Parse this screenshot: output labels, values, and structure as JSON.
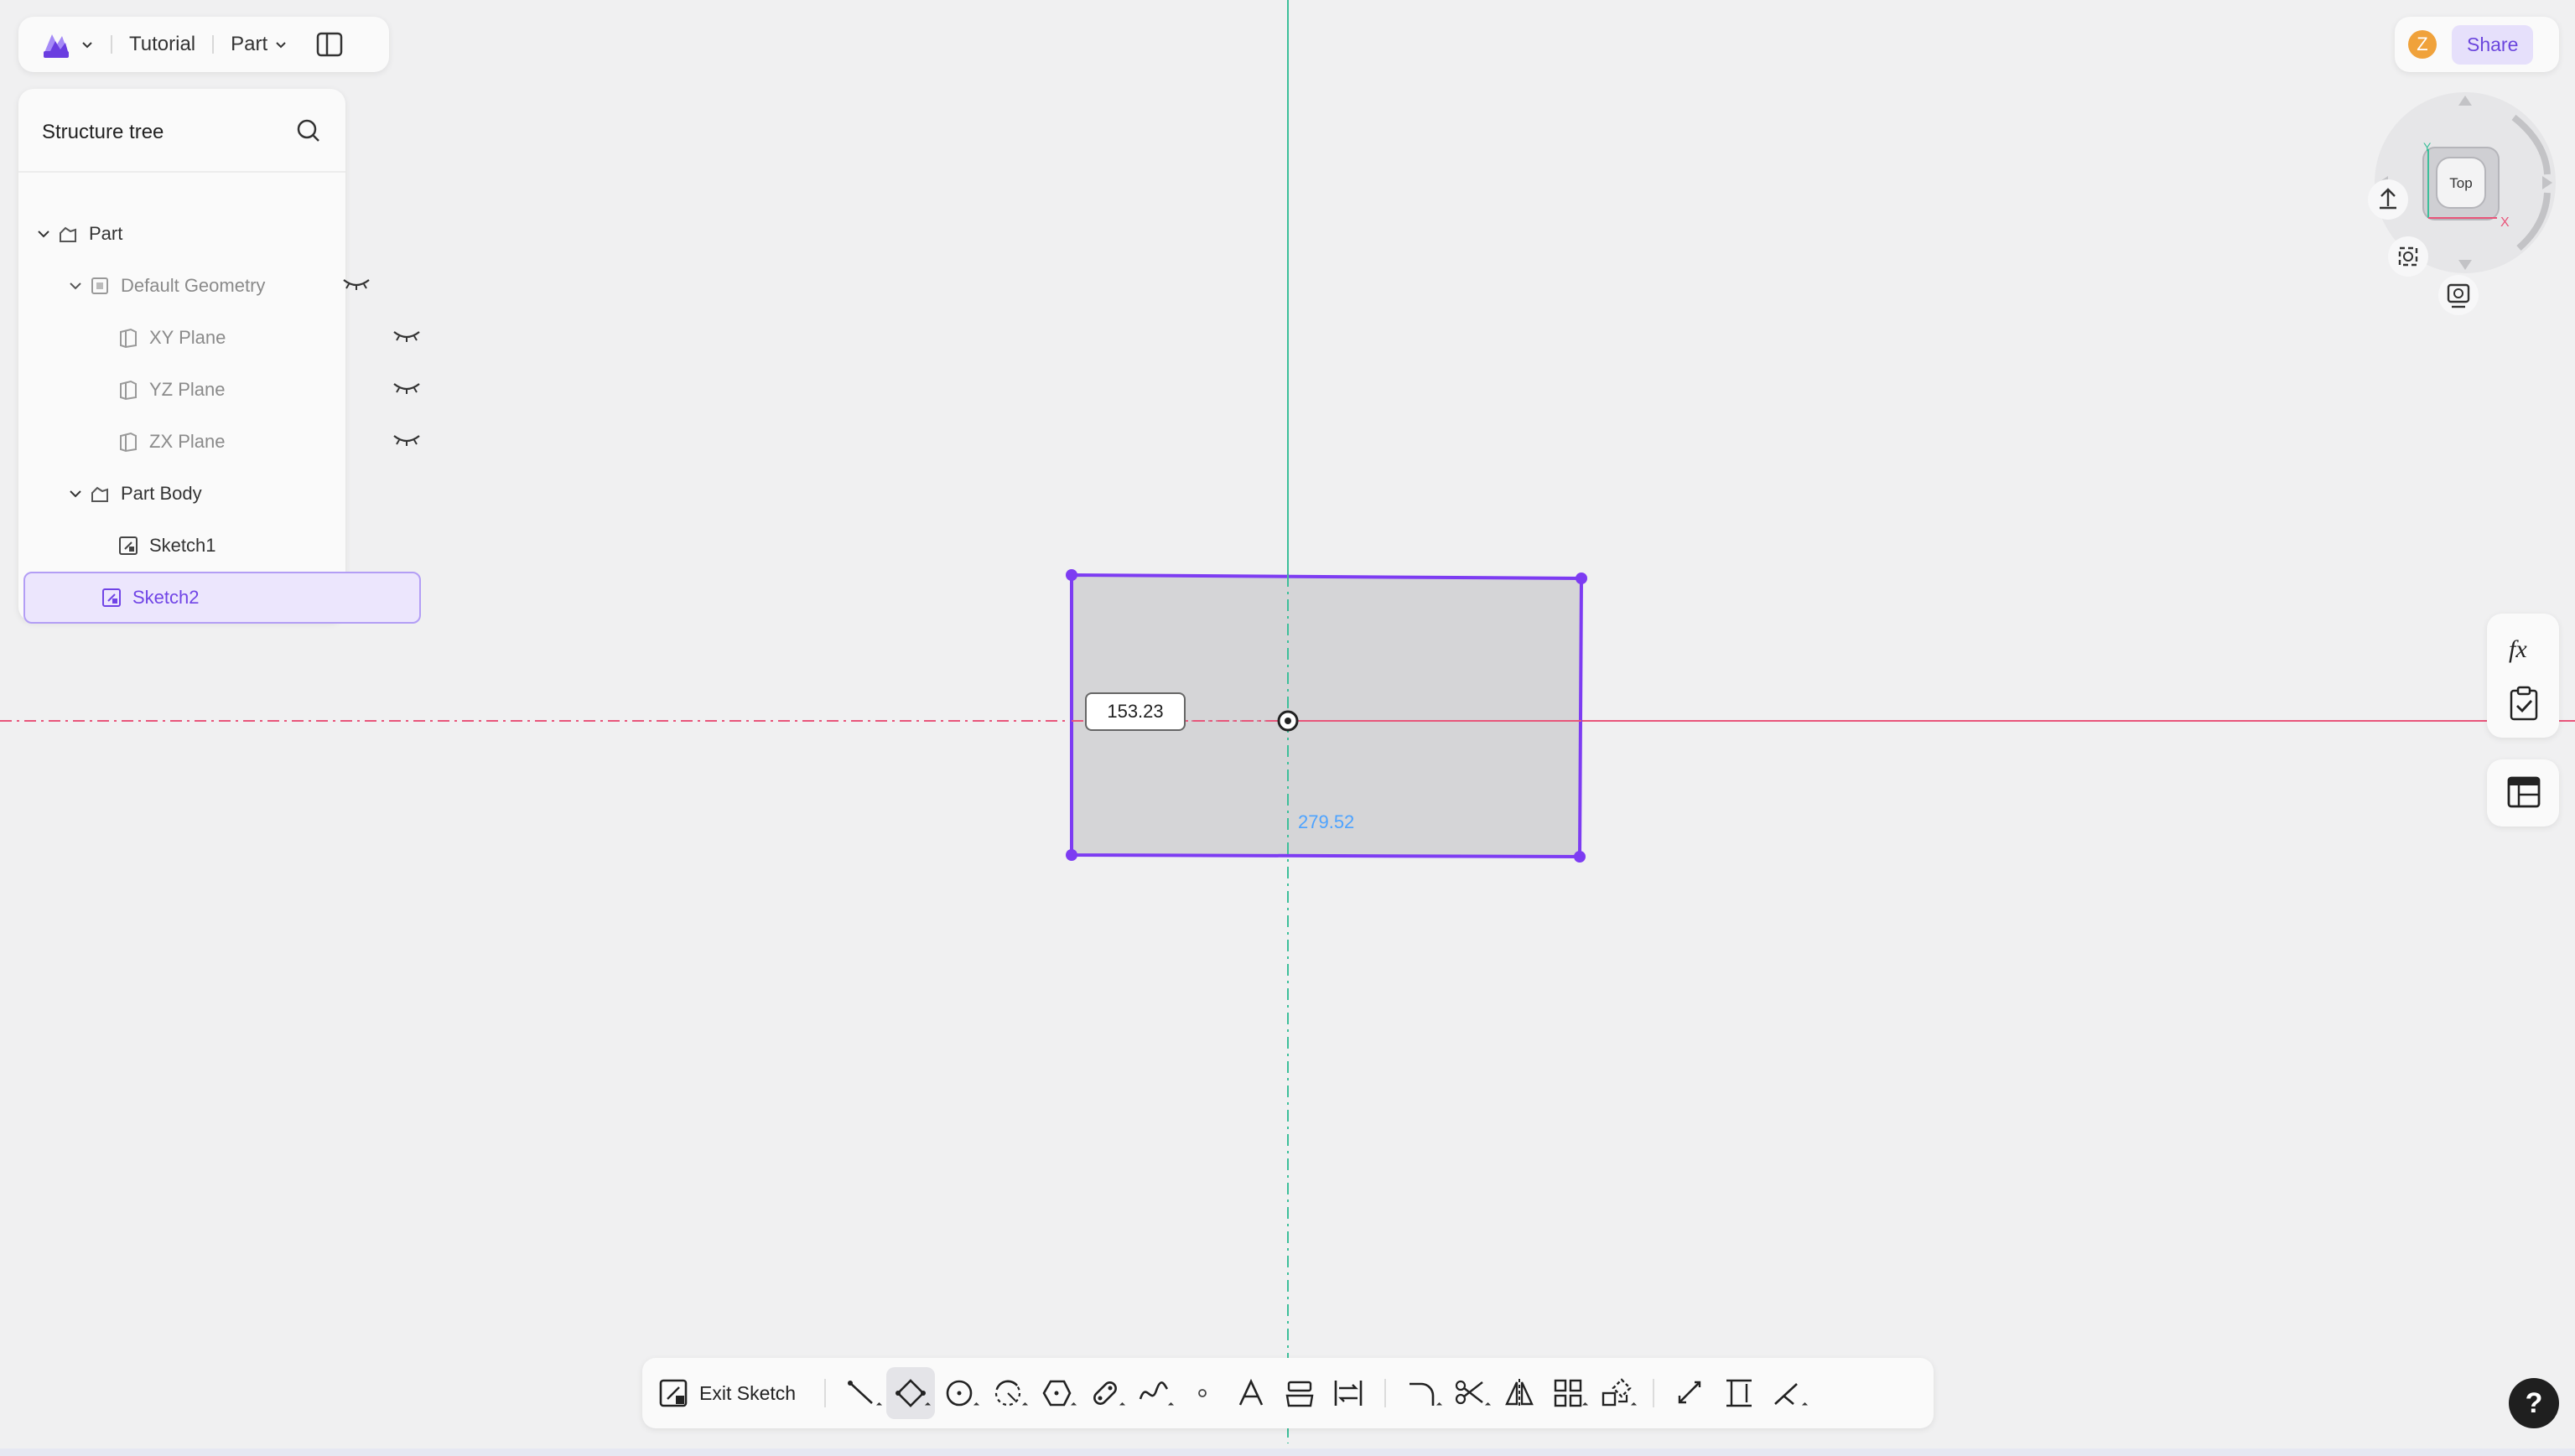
{
  "header": {
    "project_name": "Tutorial",
    "mode_label": "Part"
  },
  "tree": {
    "title": "Structure tree",
    "items": [
      {
        "label": "Part"
      },
      {
        "label": "Default Geometry"
      },
      {
        "label": "XY Plane"
      },
      {
        "label": "YZ Plane"
      },
      {
        "label": "ZX Plane"
      },
      {
        "label": "Part Body"
      },
      {
        "label": "Sketch1"
      },
      {
        "label": "Sketch2"
      }
    ]
  },
  "user": {
    "avatar_initial": "Z",
    "share_label": "Share"
  },
  "viewcube": {
    "face_label": "Top",
    "axis_x": "X",
    "axis_y": "Y"
  },
  "sketch": {
    "dimension_height": "153.23",
    "dimension_width": "279.52"
  },
  "toolbar": {
    "exit_label": "Exit Sketch"
  },
  "help": {
    "label": "?"
  },
  "colors": {
    "accent": "#7044e6",
    "rect_stroke": "#7d3cf2",
    "x_axis": "#e8557a",
    "y_axis": "#3dbf9a",
    "dim_blue": "#4da3ff"
  }
}
